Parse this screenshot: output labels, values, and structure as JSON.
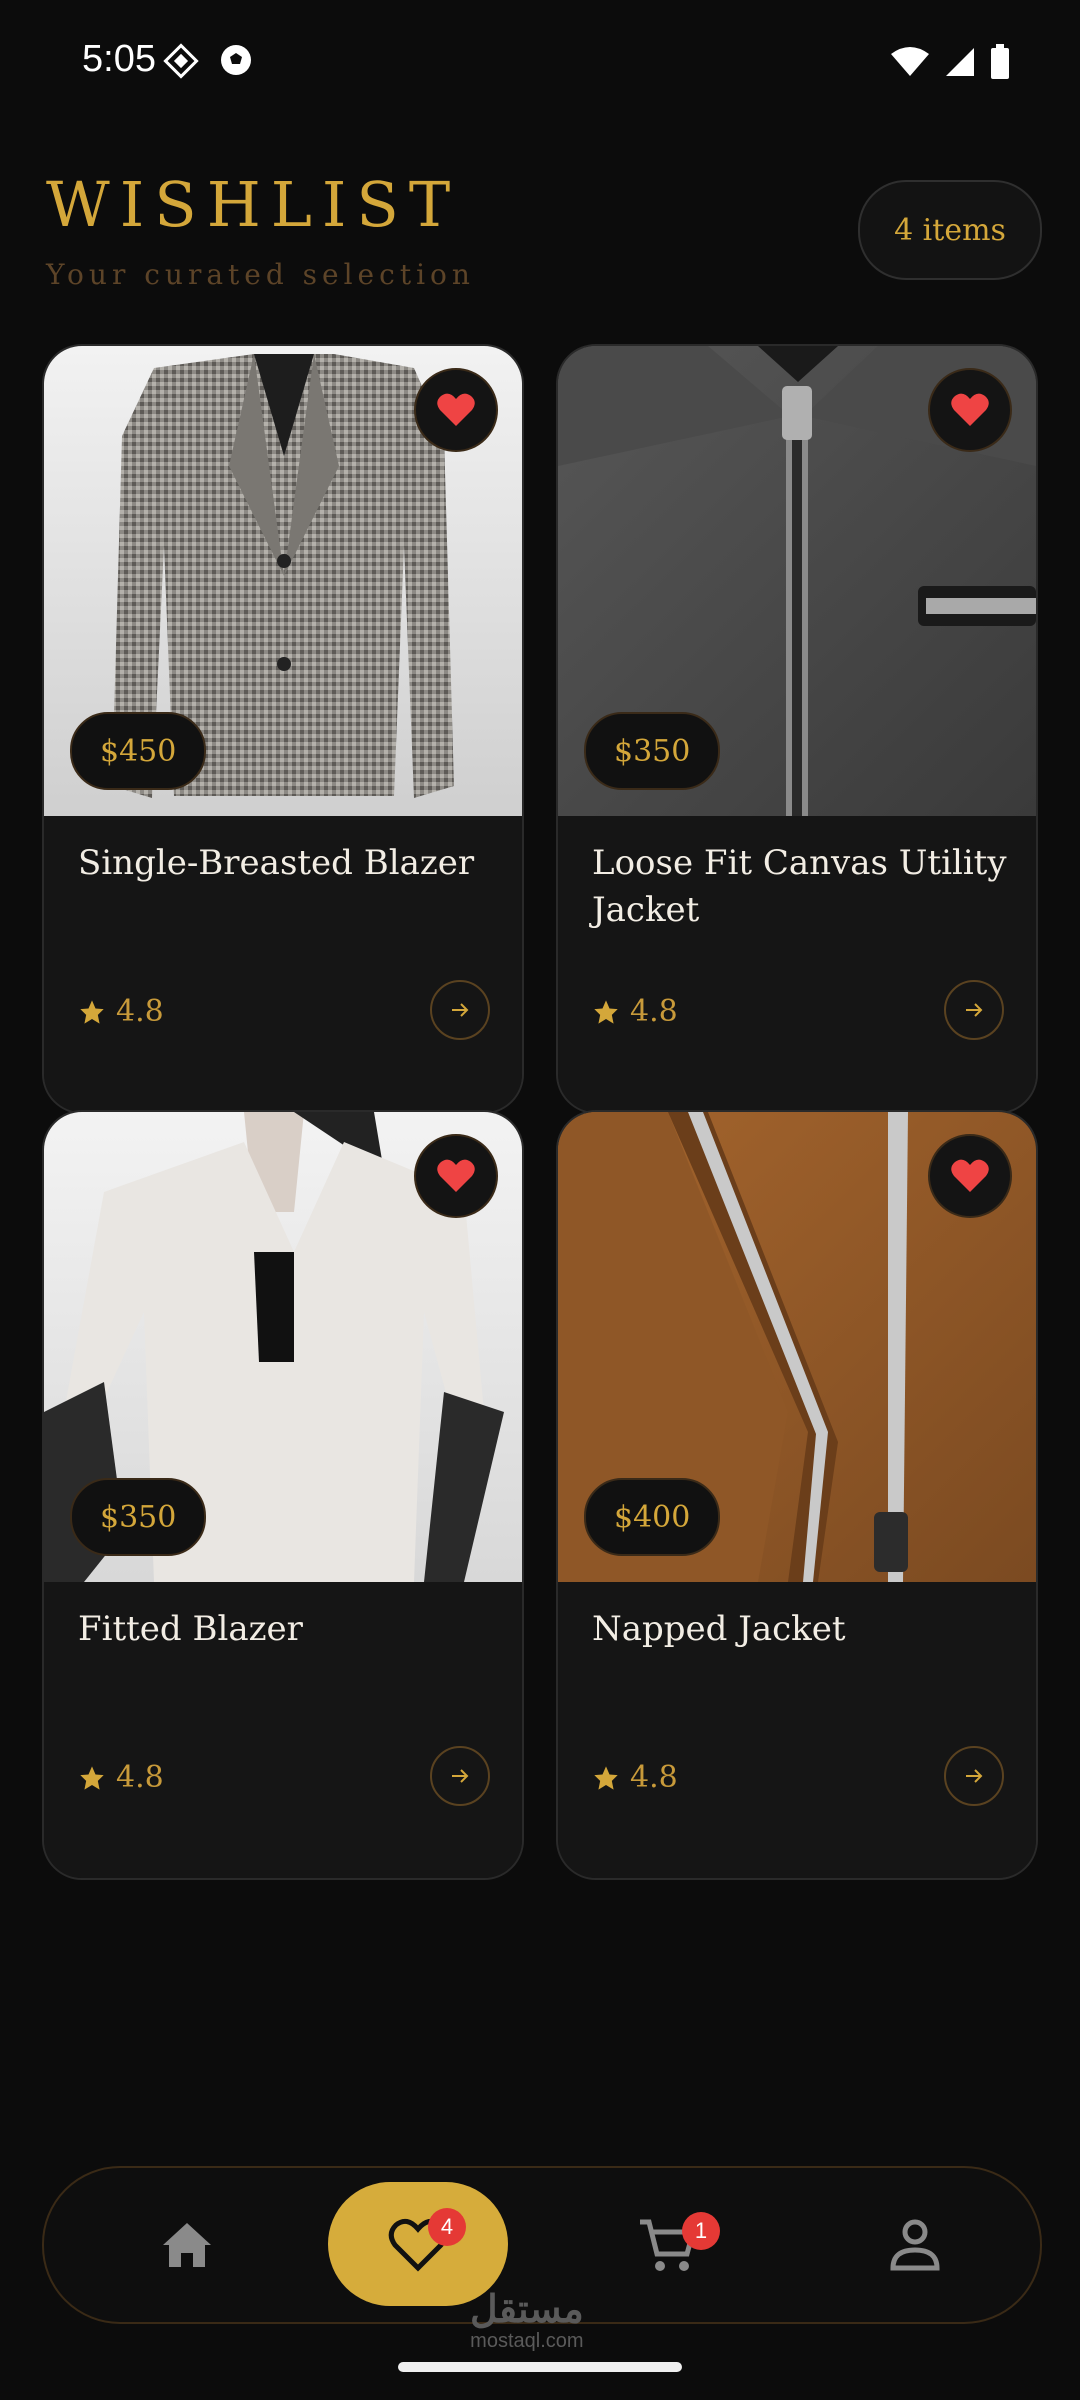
{
  "status_bar": {
    "time": "5:05"
  },
  "header": {
    "title": "WISHLIST",
    "subtitle": "Your curated selection",
    "count_label": "4 items"
  },
  "products": [
    {
      "name": "Single-Breasted Blazer",
      "price": "$450",
      "rating": "4.8",
      "image": "checked-blazer-photo"
    },
    {
      "name": "Loose Fit Canvas Utility Jacket",
      "price": "$350",
      "rating": "4.8",
      "image": "charcoal-zip-jacket-photo"
    },
    {
      "name": "Fitted Blazer",
      "price": "$350",
      "rating": "4.8",
      "image": "white-blazer-model-photo"
    },
    {
      "name": "Napped Jacket",
      "price": "$400",
      "rating": "4.8",
      "image": "brown-suede-jacket-photo"
    }
  ],
  "nav": {
    "items": [
      {
        "icon": "home-icon"
      },
      {
        "icon": "heart-icon",
        "badge": "4",
        "active": true
      },
      {
        "icon": "cart-icon",
        "badge": "1"
      },
      {
        "icon": "profile-icon"
      }
    ]
  },
  "watermark": {
    "arabic": "مستقل",
    "latin": "mostaql.com"
  },
  "colors": {
    "accent": "#d4a73a",
    "background": "#0c0c0c",
    "heart": "#e53935",
    "card": "#141414"
  }
}
